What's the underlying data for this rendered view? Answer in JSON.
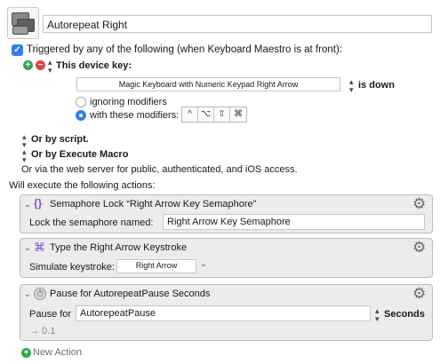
{
  "macro": {
    "name": "Autorepeat Right"
  },
  "trigger": {
    "triggered_label": "Triggered by any of the following (when Keyboard Maestro is at front):",
    "device_key_label": "This device key:",
    "device_value": "Magic Keyboard with Numeric Keypad Right Arrow",
    "key_state": "is down",
    "ignoring_label": "ignoring modifiers",
    "with_modifiers_label": "with these modifiers:",
    "modifier_keys": [
      "^",
      "⌥",
      "⇧",
      "⌘"
    ],
    "or_script": "Or by script.",
    "or_execute": "Or by Execute Macro",
    "web_server": "Or via the web server for public, authenticated, and iOS access."
  },
  "will_execute": "Will execute the following actions:",
  "actions": [
    {
      "title": "Semaphore Lock “Right Arrow Key Semaphore”",
      "field_label": "Lock the semaphore named:",
      "field_value": "Right Arrow Key Semaphore"
    },
    {
      "title": "Type the Right Arrow Keystroke",
      "field_label": "Simulate keystroke:",
      "field_value": "Right Arrow"
    },
    {
      "title": "Pause for AutorepeatPause Seconds",
      "field_label": "Pause for",
      "field_value": "AutorepeatPause",
      "unit": "Seconds",
      "result": "→ 0.1"
    }
  ],
  "new_action": "New Action",
  "colors": {
    "accent": "#2f7ff2",
    "add_green": "#2fa84f",
    "remove_red": "#e0433c",
    "panel_bg": "#ececec"
  }
}
